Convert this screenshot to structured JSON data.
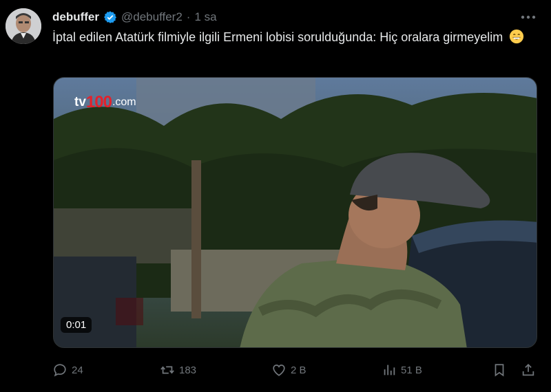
{
  "author": {
    "display_name": "debuffer",
    "handle": "@debuffer2",
    "separator": "·",
    "time": "1 sa",
    "verified": true,
    "avatar_icon": "user-avatar"
  },
  "tweet": {
    "text": "İptal edilen Atatürk filmiyle ilgili Ermeni lobisi sorulduğunda: Hiç oralara girmeyelim",
    "emoji": "grinning-face-emoji"
  },
  "media": {
    "type": "video",
    "watermark_tv": "tv",
    "watermark_number": "100",
    "watermark_domain": ".com",
    "duration": "0:01"
  },
  "actions": {
    "replies": "24",
    "reposts": "183",
    "likes": "2 B",
    "views": "51 B"
  },
  "colors": {
    "background": "#000000",
    "text": "#e7e9ea",
    "secondary": "#71767b",
    "verified_blue": "#1d9bf0",
    "watermark_red": "#e4212b"
  }
}
